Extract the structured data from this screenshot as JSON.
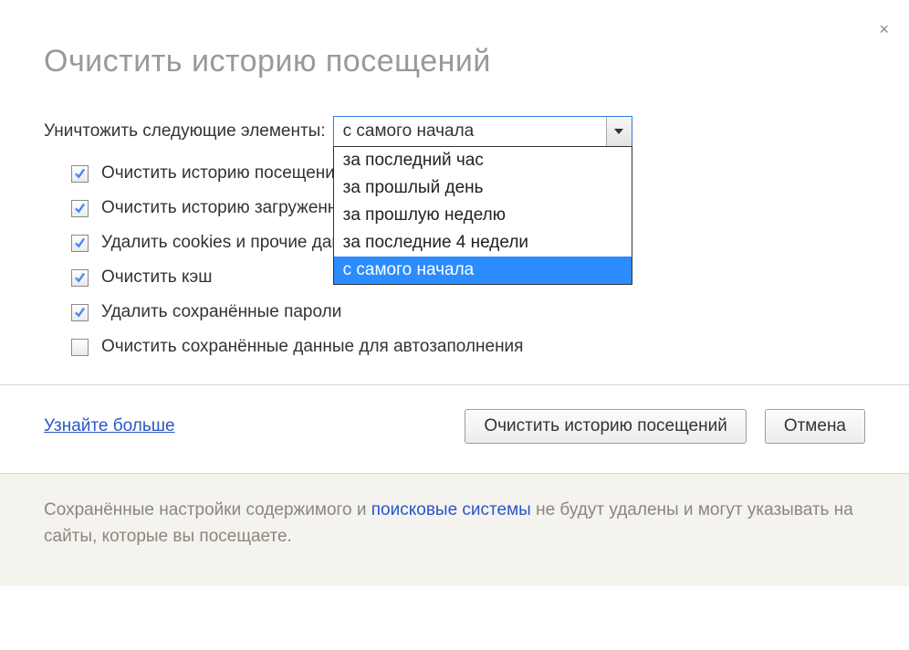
{
  "close_label": "×",
  "title": "Очистить историю посещений",
  "top_row": {
    "label": "Уничтожить следующие элементы:",
    "selected": "с самого начала",
    "options": [
      "за последний час",
      "за прошлый день",
      "за прошлую неделю",
      "за последние 4 недели",
      "с самого начала"
    ],
    "selected_index": 4
  },
  "checkboxes": [
    {
      "label": "Очистить историю посещений",
      "checked": true
    },
    {
      "label": "Очистить историю загруженны",
      "checked": true
    },
    {
      "label": "Удалить cookies и прочие данн",
      "checked": true
    },
    {
      "label": "Очистить кэш",
      "checked": true
    },
    {
      "label": "Удалить сохранённые пароли",
      "checked": true
    },
    {
      "label": "Очистить сохранённые данные для автозаполнения",
      "checked": false
    }
  ],
  "actions": {
    "learn_more": "Узнайте больше",
    "clear": "Очистить историю посещений",
    "cancel": "Отмена"
  },
  "footer": {
    "part1": "Сохранённые настройки содержимого и ",
    "link": "поисковые системы",
    "part2": " не будут удалены и могут указывать на сайты, которые вы посещаете."
  }
}
